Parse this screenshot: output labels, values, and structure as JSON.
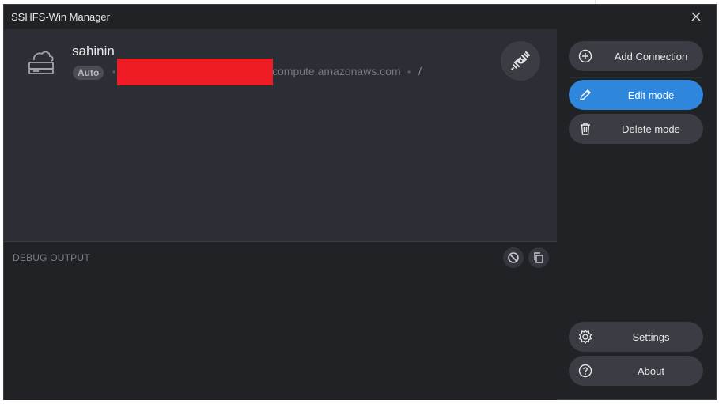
{
  "window": {
    "title": "SSHFS-Win Manager"
  },
  "connection": {
    "name": "sahinin",
    "mode_badge": "Auto",
    "host_suffix": "compute.amazonaws.com",
    "path": "/"
  },
  "debug": {
    "label": "DEBUG OUTPUT"
  },
  "sidebar": {
    "add_connection": "Add Connection",
    "edit_mode": "Edit mode",
    "delete_mode": "Delete mode",
    "settings": "Settings",
    "about": "About"
  },
  "colors": {
    "accent": "#2f86dd",
    "redaction": "#ee1c25",
    "panel": "#2b2e34",
    "sidebar": "#202225"
  },
  "icons": [
    "close-icon",
    "server-icon",
    "plug-disconnect-icon",
    "clear-icon",
    "copy-icon",
    "plus-circle-icon",
    "pencil-icon",
    "trash-icon",
    "gear-icon",
    "question-circle-icon"
  ]
}
